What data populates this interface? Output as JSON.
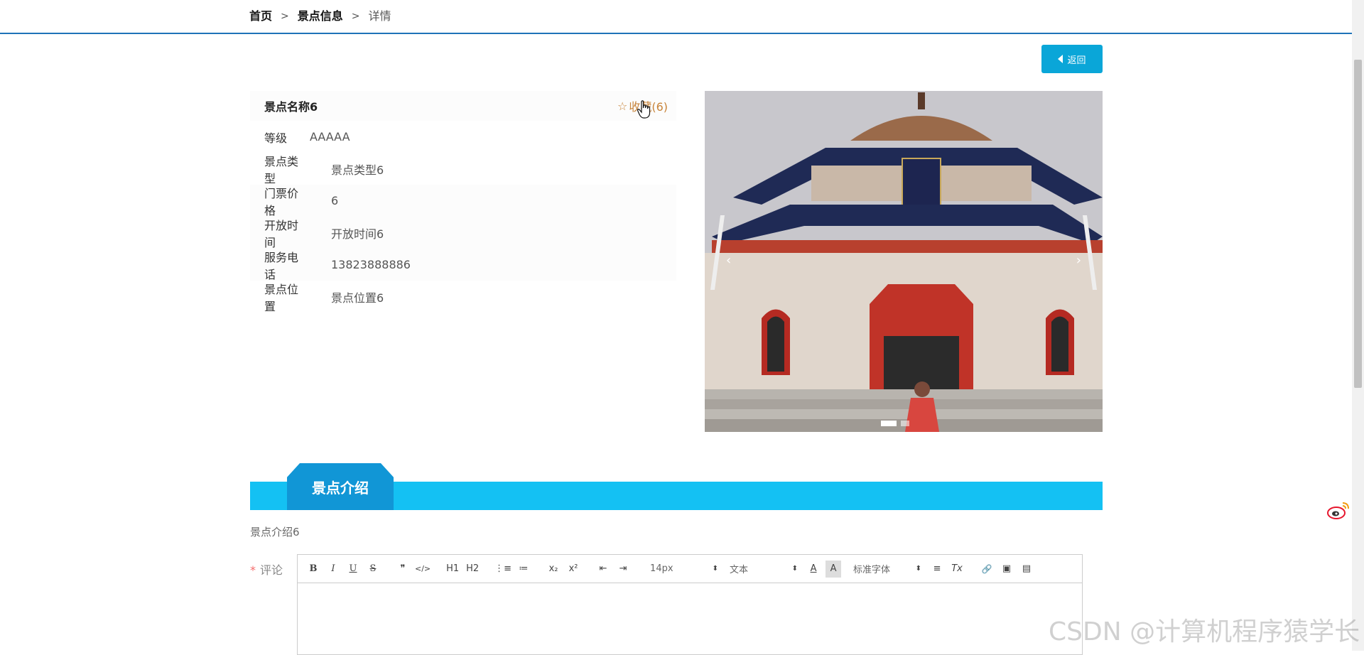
{
  "breadcrumb": {
    "home": "首页",
    "sep1": ">",
    "list": "景点信息",
    "sep2": ">",
    "current": "详情"
  },
  "back_button": {
    "label": "返回"
  },
  "attraction": {
    "name": "景点名称6",
    "favorite": {
      "star": "☆",
      "label": "收藏(6)"
    },
    "fields": [
      {
        "label": "等级",
        "value": "AAAAA"
      },
      {
        "label": "景点类型",
        "value": "景点类型6"
      },
      {
        "label": "门票价格",
        "value": "6"
      },
      {
        "label": "开放时间",
        "value": "开放时间6"
      },
      {
        "label": "服务电话",
        "value": "13823888886"
      },
      {
        "label": "景点位置",
        "value": "景点位置6"
      }
    ]
  },
  "carousel": {
    "prev": "‹",
    "next": "›",
    "slide_count": 2,
    "active_index": 0
  },
  "section": {
    "title": "景点介绍"
  },
  "intro": {
    "text": "景点介绍6"
  },
  "comment": {
    "required_mark": "*",
    "label": "评论",
    "toolbar": {
      "bold": "B",
      "italic": "I",
      "underline": "U",
      "strike": "S",
      "quote": "❞",
      "code": "</>",
      "h1": "H1",
      "h2": "H2",
      "ordered_list": "⋮≡",
      "bullet_list": "≔",
      "subscript": "x₂",
      "superscript": "x²",
      "outdent": "⇤",
      "indent": "⇥",
      "size_select": "14px",
      "type_select": "文本",
      "font_color": "A",
      "background_color": "A",
      "font_select": "标准字体",
      "align": "≡",
      "clean": "Tx",
      "link": "🔗",
      "image": "▣",
      "video": "▤"
    }
  },
  "watermark": "CSDN @计算机程序猿学长",
  "colors": {
    "accent": "#1e73b8",
    "button": "#0aa6d8",
    "section_bar": "#14c1f3",
    "favorite": "#c8843a"
  }
}
